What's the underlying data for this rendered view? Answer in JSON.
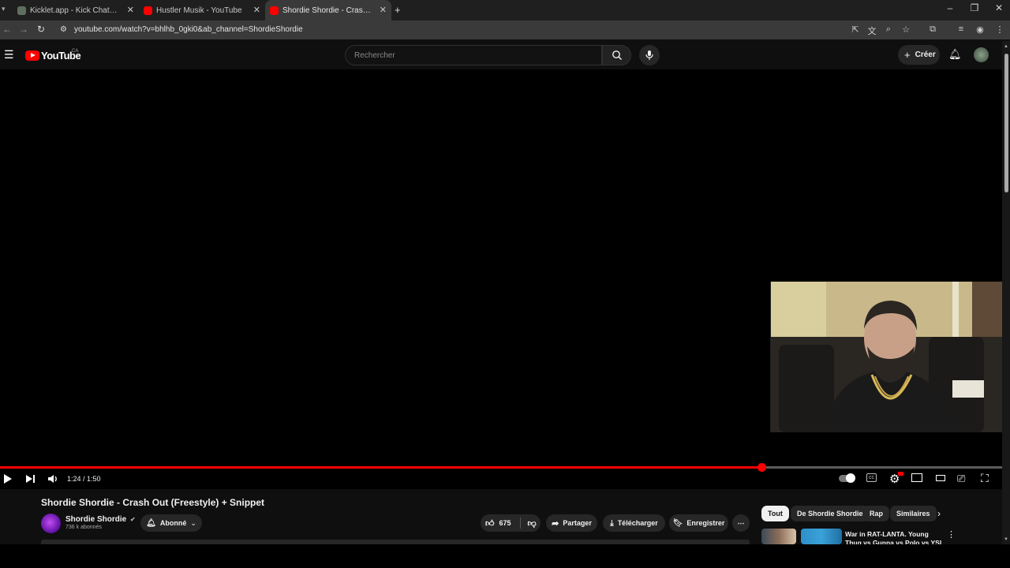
{
  "browser": {
    "tabs": [
      {
        "label": "Kicklet.app - Kick Chatbot and",
        "favicon_color": "#5f6f5f",
        "active": false
      },
      {
        "label": "Hustler Musik - YouTube",
        "favicon_color": "#ff0000",
        "active": false
      },
      {
        "label": "Shordie Shordie - Crash Out (F",
        "favicon_color": "#ff0000",
        "active": true
      }
    ],
    "new_tab": "+",
    "url": "youtube.com/watch?v=bhlhb_0gki0&ab_channel=ShordieShordie"
  },
  "youtube": {
    "logo_text": "YouTube",
    "country": "CA",
    "search_placeholder": "Rechercher",
    "create_label": "Créer"
  },
  "player": {
    "time": "1:24 / 1:50",
    "progress": 0.76
  },
  "video": {
    "title": "Shordie Shordie - Crash Out (Freestyle) + Snippet",
    "channel": "Shordie Shordie",
    "subscribers": "736 k abonnés",
    "subscribe_label": "Abonné",
    "likes": "675",
    "share": "Partager",
    "download": "Télécharger",
    "save": "Enregistrer"
  },
  "chips": [
    {
      "label": "Tout",
      "selected": true
    },
    {
      "label": "De Shordie Shordie",
      "selected": false
    },
    {
      "label": "Rap",
      "selected": false
    },
    {
      "label": "Similaires",
      "selected": false
    }
  ],
  "recommendation": {
    "title": "War in RAT-LANTA. Young Thug vs Gunna vs Polo vs YSL"
  },
  "colors": {
    "accent": "#ff0000",
    "background": "#0f0f0f"
  }
}
